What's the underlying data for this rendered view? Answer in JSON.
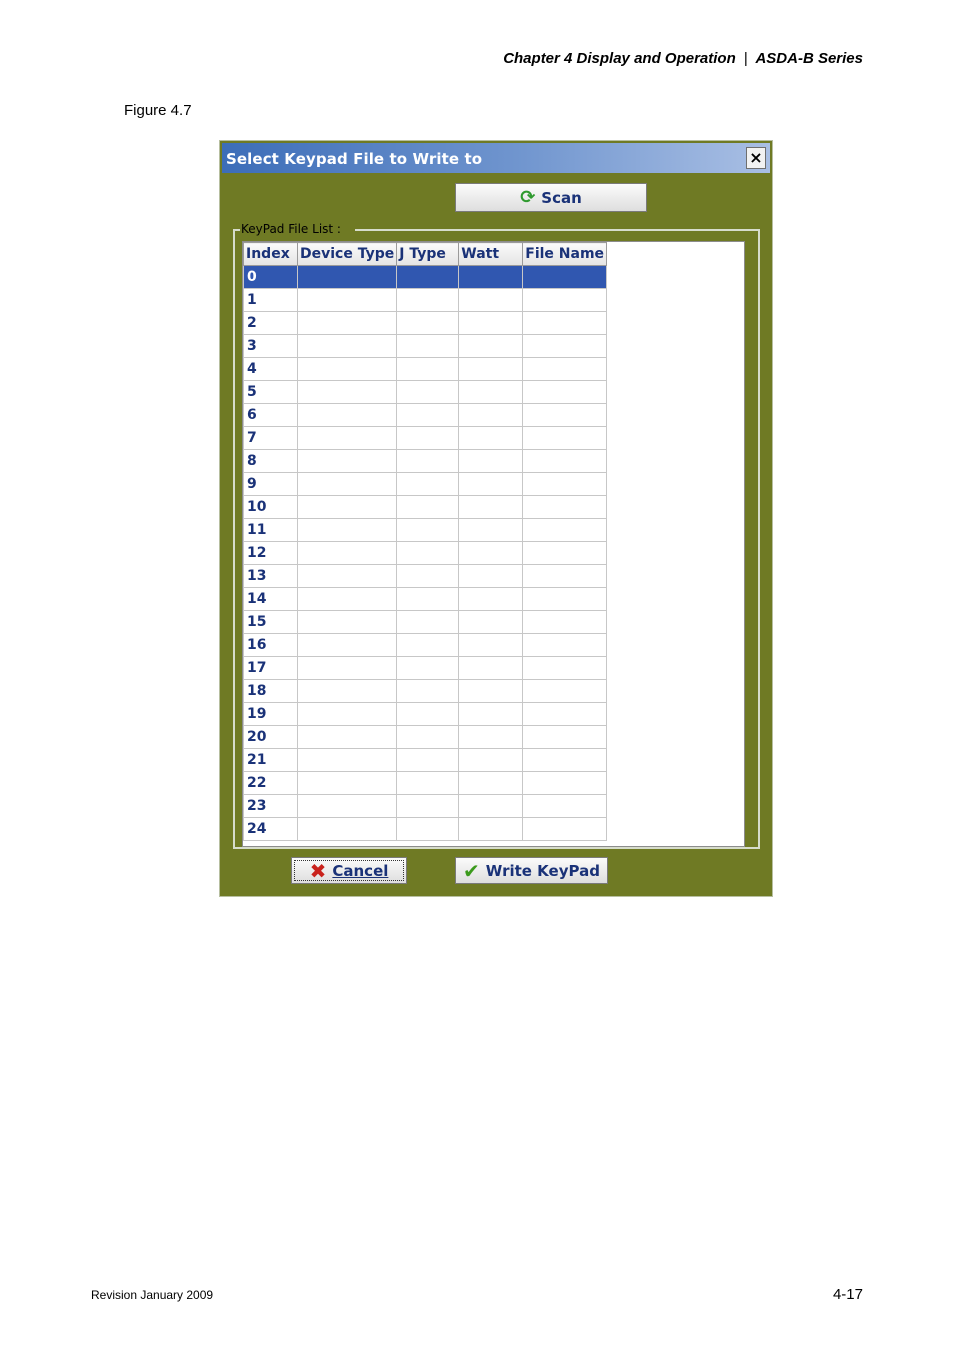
{
  "page": {
    "header": {
      "chapter": "Chapter 4  Display and Operation",
      "separator": "|",
      "series": "ASDA-B Series"
    },
    "figure_label": "Figure 4.7",
    "footer_left": "Revision January 2009",
    "footer_right": "4-17"
  },
  "dialog": {
    "title": "Select Keypad File to Write to",
    "close_label": "×",
    "scan_label": "Scan",
    "group_label": "KeyPad File List :",
    "columns": [
      "Index",
      "Device Type",
      "J Type",
      "Watt",
      "File Name"
    ],
    "rows": [
      {
        "index": "0"
      },
      {
        "index": "1"
      },
      {
        "index": "2"
      },
      {
        "index": "3"
      },
      {
        "index": "4"
      },
      {
        "index": "5"
      },
      {
        "index": "6"
      },
      {
        "index": "7"
      },
      {
        "index": "8"
      },
      {
        "index": "9"
      },
      {
        "index": "10"
      },
      {
        "index": "11"
      },
      {
        "index": "12"
      },
      {
        "index": "13"
      },
      {
        "index": "14"
      },
      {
        "index": "15"
      },
      {
        "index": "16"
      },
      {
        "index": "17"
      },
      {
        "index": "18"
      },
      {
        "index": "19"
      },
      {
        "index": "20"
      },
      {
        "index": "21"
      },
      {
        "index": "22"
      },
      {
        "index": "23"
      },
      {
        "index": "24"
      }
    ],
    "selected_row": 0,
    "cancel_label": "Cancel",
    "write_label": "Write KeyPad"
  },
  "colors": {
    "dialog_background": "#6f7a24",
    "selection": "#3057b0",
    "text_blue": "#1a3278"
  },
  "icons": {
    "scan": "refresh-icon",
    "cancel": "red-x-icon",
    "write": "green-check-icon"
  }
}
